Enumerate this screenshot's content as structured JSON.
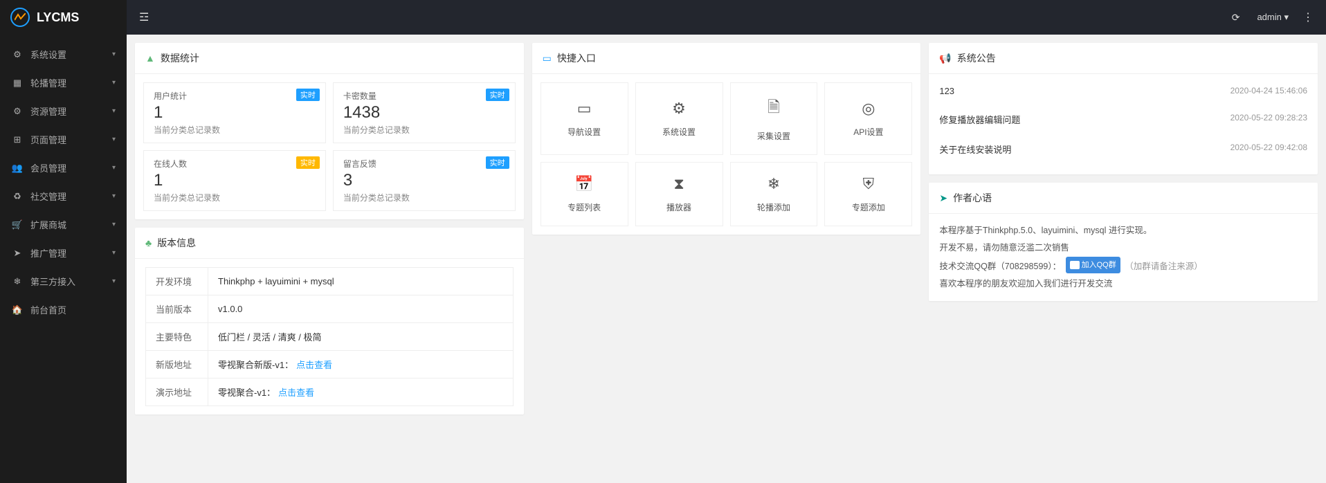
{
  "brand": "LYCMS",
  "topbar": {
    "user_label": "admin ▾"
  },
  "sidebar": {
    "items": [
      {
        "label": "系统设置"
      },
      {
        "label": "轮播管理"
      },
      {
        "label": "资源管理"
      },
      {
        "label": "页面管理"
      },
      {
        "label": "会员管理"
      },
      {
        "label": "社交管理"
      },
      {
        "label": "扩展商城"
      },
      {
        "label": "推广管理"
      },
      {
        "label": "第三方接入"
      },
      {
        "label": "前台首页"
      }
    ]
  },
  "stats": {
    "header": "数据统计",
    "cards": [
      {
        "label": "用户统计",
        "value": "1",
        "sub": "当前分类总记录数",
        "badge": "实时",
        "badge_color": "blue"
      },
      {
        "label": "卡密数量",
        "value": "1438",
        "sub": "当前分类总记录数",
        "badge": "实时",
        "badge_color": "blue"
      },
      {
        "label": "在线人数",
        "value": "1",
        "sub": "当前分类总记录数",
        "badge": "实时",
        "badge_color": "orange"
      },
      {
        "label": "留言反馈",
        "value": "3",
        "sub": "当前分类总记录数",
        "badge": "实时",
        "badge_color": "blue"
      }
    ]
  },
  "quick": {
    "header": "快捷入口",
    "items": [
      {
        "label": "导航设置"
      },
      {
        "label": "系统设置"
      },
      {
        "label": "采集设置"
      },
      {
        "label": "API设置"
      },
      {
        "label": "专题列表"
      },
      {
        "label": "播放器"
      },
      {
        "label": "轮播添加"
      },
      {
        "label": "专题添加"
      }
    ]
  },
  "ann": {
    "header": "系统公告",
    "items": [
      {
        "title": "123",
        "time": "2020-04-24 15:46:06"
      },
      {
        "title": "修复播放器编辑问题",
        "time": "2020-05-22 09:28:23"
      },
      {
        "title": "关于在线安装说明",
        "time": "2020-05-22 09:42:08"
      }
    ]
  },
  "author": {
    "header": "作者心语",
    "line1": "本程序基于Thinkphp.5.0、layuimini、mysql 进行实现。",
    "line2": "开发不易，请勿随意泛滥二次销售",
    "line3_pre": "技术交流QQ群（708298599）：",
    "line3_badge": "加入QQ群",
    "line3_suf": "（加群请备注来源）",
    "line4": "喜欢本程序的朋友欢迎加入我们进行开发交流"
  },
  "ver": {
    "header": "版本信息",
    "rows": [
      {
        "k": "开发环境",
        "v": "Thinkphp + layuimini + mysql"
      },
      {
        "k": "当前版本",
        "v": "v1.0.0"
      },
      {
        "k": "主要特色",
        "v": "低门栏 / 灵活 / 清爽 / 极简"
      },
      {
        "k": "新版地址",
        "v_pre": "零视聚合新版-v1：",
        "v_link": "点击查看"
      },
      {
        "k": "演示地址",
        "v_pre": "零视聚合-v1：",
        "v_link": "点击查看"
      }
    ]
  }
}
